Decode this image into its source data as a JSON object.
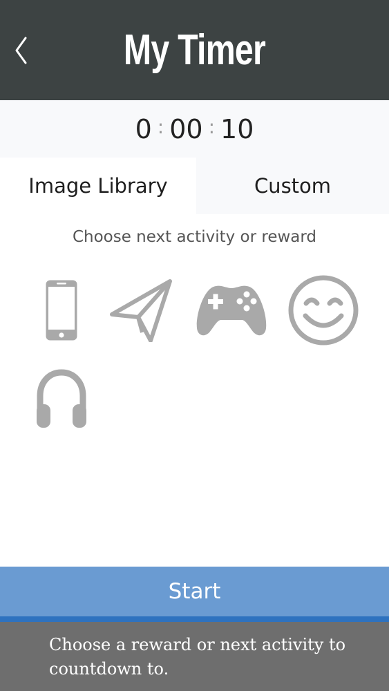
{
  "header": {
    "title": "My Timer",
    "back_icon": "chevron-left-icon"
  },
  "timer": {
    "hours": "0",
    "minutes": "00",
    "seconds": "10",
    "separator": ":"
  },
  "tabs": [
    {
      "label": "Image Library",
      "active": true
    },
    {
      "label": "Custom",
      "active": false
    }
  ],
  "prompt": "Choose next activity or reward",
  "activities": [
    {
      "icon": "phone-icon"
    },
    {
      "icon": "paper-plane-icon"
    },
    {
      "icon": "game-controller-icon"
    },
    {
      "icon": "smiley-face-icon"
    },
    {
      "icon": "headphones-icon"
    }
  ],
  "start_button": {
    "label": "Start"
  },
  "footer": {
    "message": "Choose a reward or next activity to countdown to."
  },
  "colors": {
    "header_bg": "#3d4343",
    "icon_gray": "#a9a9a9",
    "start_bg": "#6a9bd2",
    "start_border": "#2e72bf",
    "footer_bg": "#6e6e6e"
  }
}
